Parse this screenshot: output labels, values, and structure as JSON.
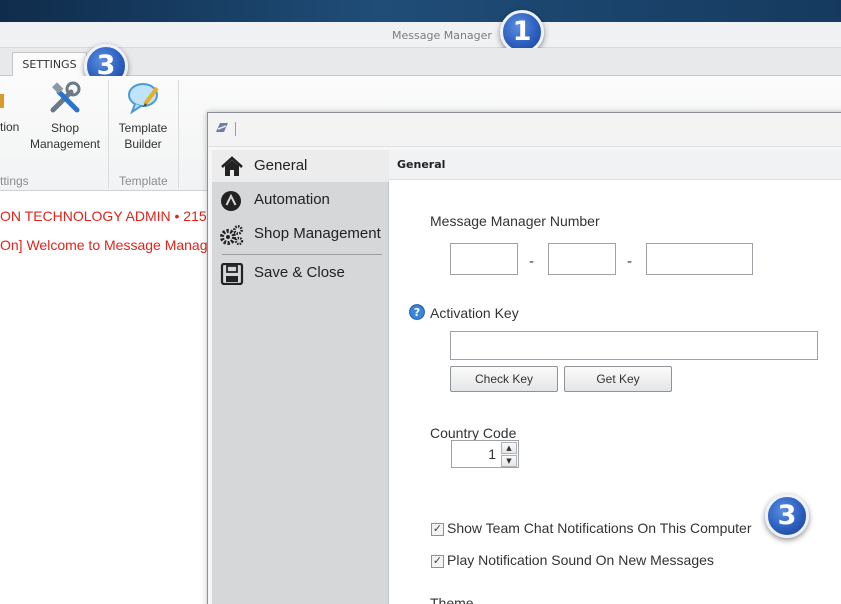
{
  "app": {
    "title": "Message Manager"
  },
  "ribbon": {
    "tab_settings": "SETTINGS",
    "partial_button_label": "tion",
    "shop_management_line1": "Shop",
    "shop_management_line2": "Management",
    "template_builder_line1": "Template",
    "template_builder_line2": "Builder",
    "group_settings_partial": "ttings",
    "group_template": "Template"
  },
  "log": {
    "line1": "ON TECHNOLOGY ADMIN • 215",
    "line2": "On] Welcome to Message Manag"
  },
  "dialog": {
    "nav": {
      "items": [
        {
          "label": "General",
          "icon": "home-icon"
        },
        {
          "label": "Automation",
          "icon": "automation-icon"
        },
        {
          "label": "Shop Management",
          "icon": "gears-icon"
        },
        {
          "label": "Save & Close",
          "icon": "save-icon"
        }
      ]
    },
    "header": "General",
    "mm_number_label": "Message Manager Number",
    "mm_number_parts": [
      "",
      "",
      ""
    ],
    "separator": "-",
    "activation_label": "Activation Key",
    "activation_value": "",
    "check_key": "Check Key",
    "get_key": "Get Key",
    "country_code_label": "Country Code",
    "country_code_value": "1",
    "checkbox1": {
      "label": "Show Team Chat Notifications On This Computer",
      "checked": true
    },
    "checkbox2": {
      "label": "Play Notification Sound On New Messages",
      "checked": true
    },
    "theme_label": "Theme"
  },
  "badges": {
    "title_badge": "1",
    "settings_badge": "3",
    "notifications_badge": "3"
  },
  "colors": {
    "accent_red": "#e0241b",
    "badge_blue": "#2c5fbf",
    "header_navy": "#163a5f"
  }
}
